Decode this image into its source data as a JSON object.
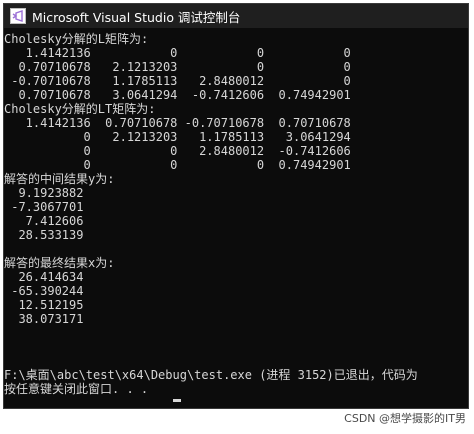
{
  "window": {
    "title": "Microsoft Visual Studio 调试控制台",
    "icon": "visual-studio-icon"
  },
  "console": {
    "lines": [
      "Cholesky分解的L矩阵为:",
      "   1.4142136           0           0           0",
      "  0.70710678   2.1213203           0           0",
      " -0.70710678   1.1785113   2.8480012           0",
      "  0.70710678   3.0641294  -0.7412606  0.74942901",
      "Cholesky分解的LT矩阵为:",
      "   1.4142136  0.70710678 -0.70710678  0.70710678",
      "           0   2.1213203   1.1785113   3.0641294",
      "           0           0   2.8480012  -0.7412606",
      "           0           0           0  0.74942901",
      "解答的中间结果y为:",
      "  9.1923882",
      " -7.3067701",
      "   7.412606",
      "  28.533139",
      "",
      "解答的最终结果x为:",
      "  26.414634",
      " -65.390244",
      "  12.512195",
      "  38.073171",
      "",
      "",
      "",
      "F:\\桌面\\abc\\test\\x64\\Debug\\test.exe (进程 3152)已退出，代码为",
      "按任意键关闭此窗口. . ."
    ]
  },
  "watermark": "CSDN @想学摄影的IT男",
  "colors": {
    "console_bg": "#0c0c0c",
    "console_text": "#d7d7d7",
    "titlebar_bg": "#1f1f1f",
    "vs_purple": "#9b6fd6"
  }
}
